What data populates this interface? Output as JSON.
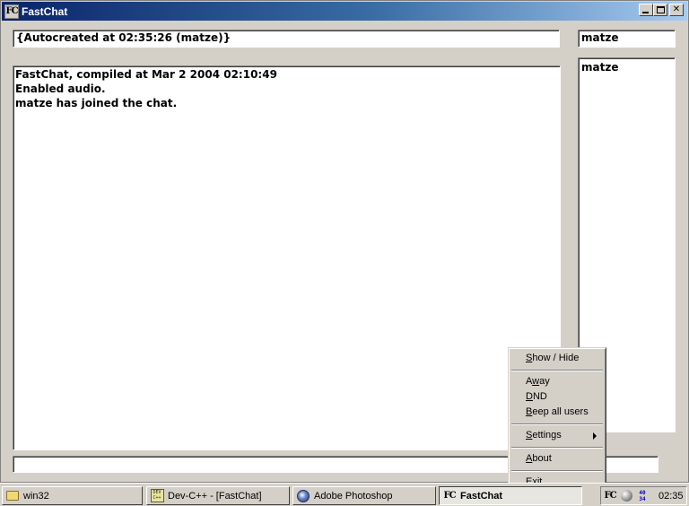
{
  "window": {
    "title": "FastChat",
    "icon_text": "FC"
  },
  "topic": "{Autocreated at 02:35:26 (matze)}",
  "nickname": "matze",
  "chat_log": [
    "FastChat, compiled at Mar  2 2004 02:10:49",
    "Enabled audio.",
    "matze has joined the chat."
  ],
  "users": [
    "matze"
  ],
  "message_input": "",
  "context_menu": {
    "items": [
      {
        "pre": "",
        "u": "S",
        "post": "how / Hide"
      },
      {
        "pre": "A",
        "u": "w",
        "post": "ay"
      },
      {
        "pre": "",
        "u": "D",
        "post": "ND"
      },
      {
        "pre": "",
        "u": "B",
        "post": "eep all users"
      },
      {
        "pre": "",
        "u": "S",
        "post": "ettings"
      },
      {
        "pre": "",
        "u": "A",
        "post": "bout"
      },
      {
        "pre": "",
        "u": "E",
        "post": "xit"
      }
    ]
  },
  "taskbar": {
    "tasks": [
      {
        "label": "win32",
        "icon": "folder-icon"
      },
      {
        "label": "Dev-C++ - [FastChat]",
        "icon": "devcpp-icon"
      },
      {
        "label": "Adobe Photoshop",
        "icon": "photoshop-icon"
      },
      {
        "label": "FastChat",
        "icon": "fastchat-icon",
        "active": true
      }
    ],
    "tray": {
      "fc_text": "FC",
      "nums_top": "40",
      "nums_bottom": "34",
      "clock": "02:35"
    },
    "devcpp_icon_text": "DEV C++"
  }
}
